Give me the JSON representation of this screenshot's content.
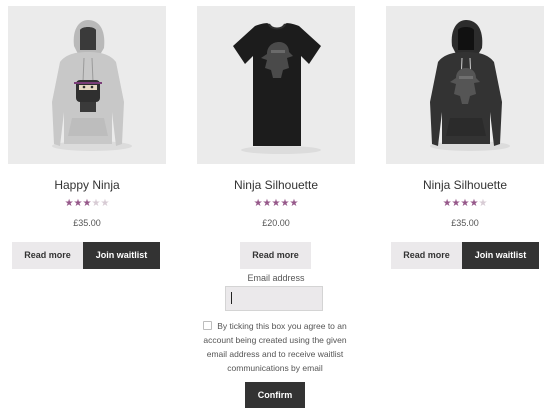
{
  "products": [
    {
      "title": "Happy Ninja",
      "rating": 3,
      "rating_max": 5,
      "price": "£35.00",
      "garment": "hoodie-light",
      "read_more_label": "Read more",
      "waitlist_label": "Join waitlist"
    },
    {
      "title": "Ninja Silhouette",
      "rating": 5,
      "rating_max": 5,
      "price": "£20.00",
      "garment": "tshirt-black",
      "read_more_label": "Read more"
    },
    {
      "title": "Ninja Silhouette",
      "rating": 4,
      "rating_max": 5,
      "price": "£35.00",
      "garment": "hoodie-dark",
      "read_more_label": "Read more",
      "waitlist_label": "Join waitlist"
    }
  ],
  "waitlist_form": {
    "email_label": "Email address",
    "email_value": "",
    "consent_text_lines": [
      "By ticking this box you agree to an",
      "account being created using the given",
      "email address and to receive waitlist",
      "communications by email"
    ],
    "confirm_label": "Confirm"
  },
  "colors": {
    "star_filled": "#96588a",
    "star_empty": "#d8ccd5",
    "button_dark": "#333333",
    "button_light": "#ebe9eb",
    "image_bg": "#ebebeb"
  }
}
